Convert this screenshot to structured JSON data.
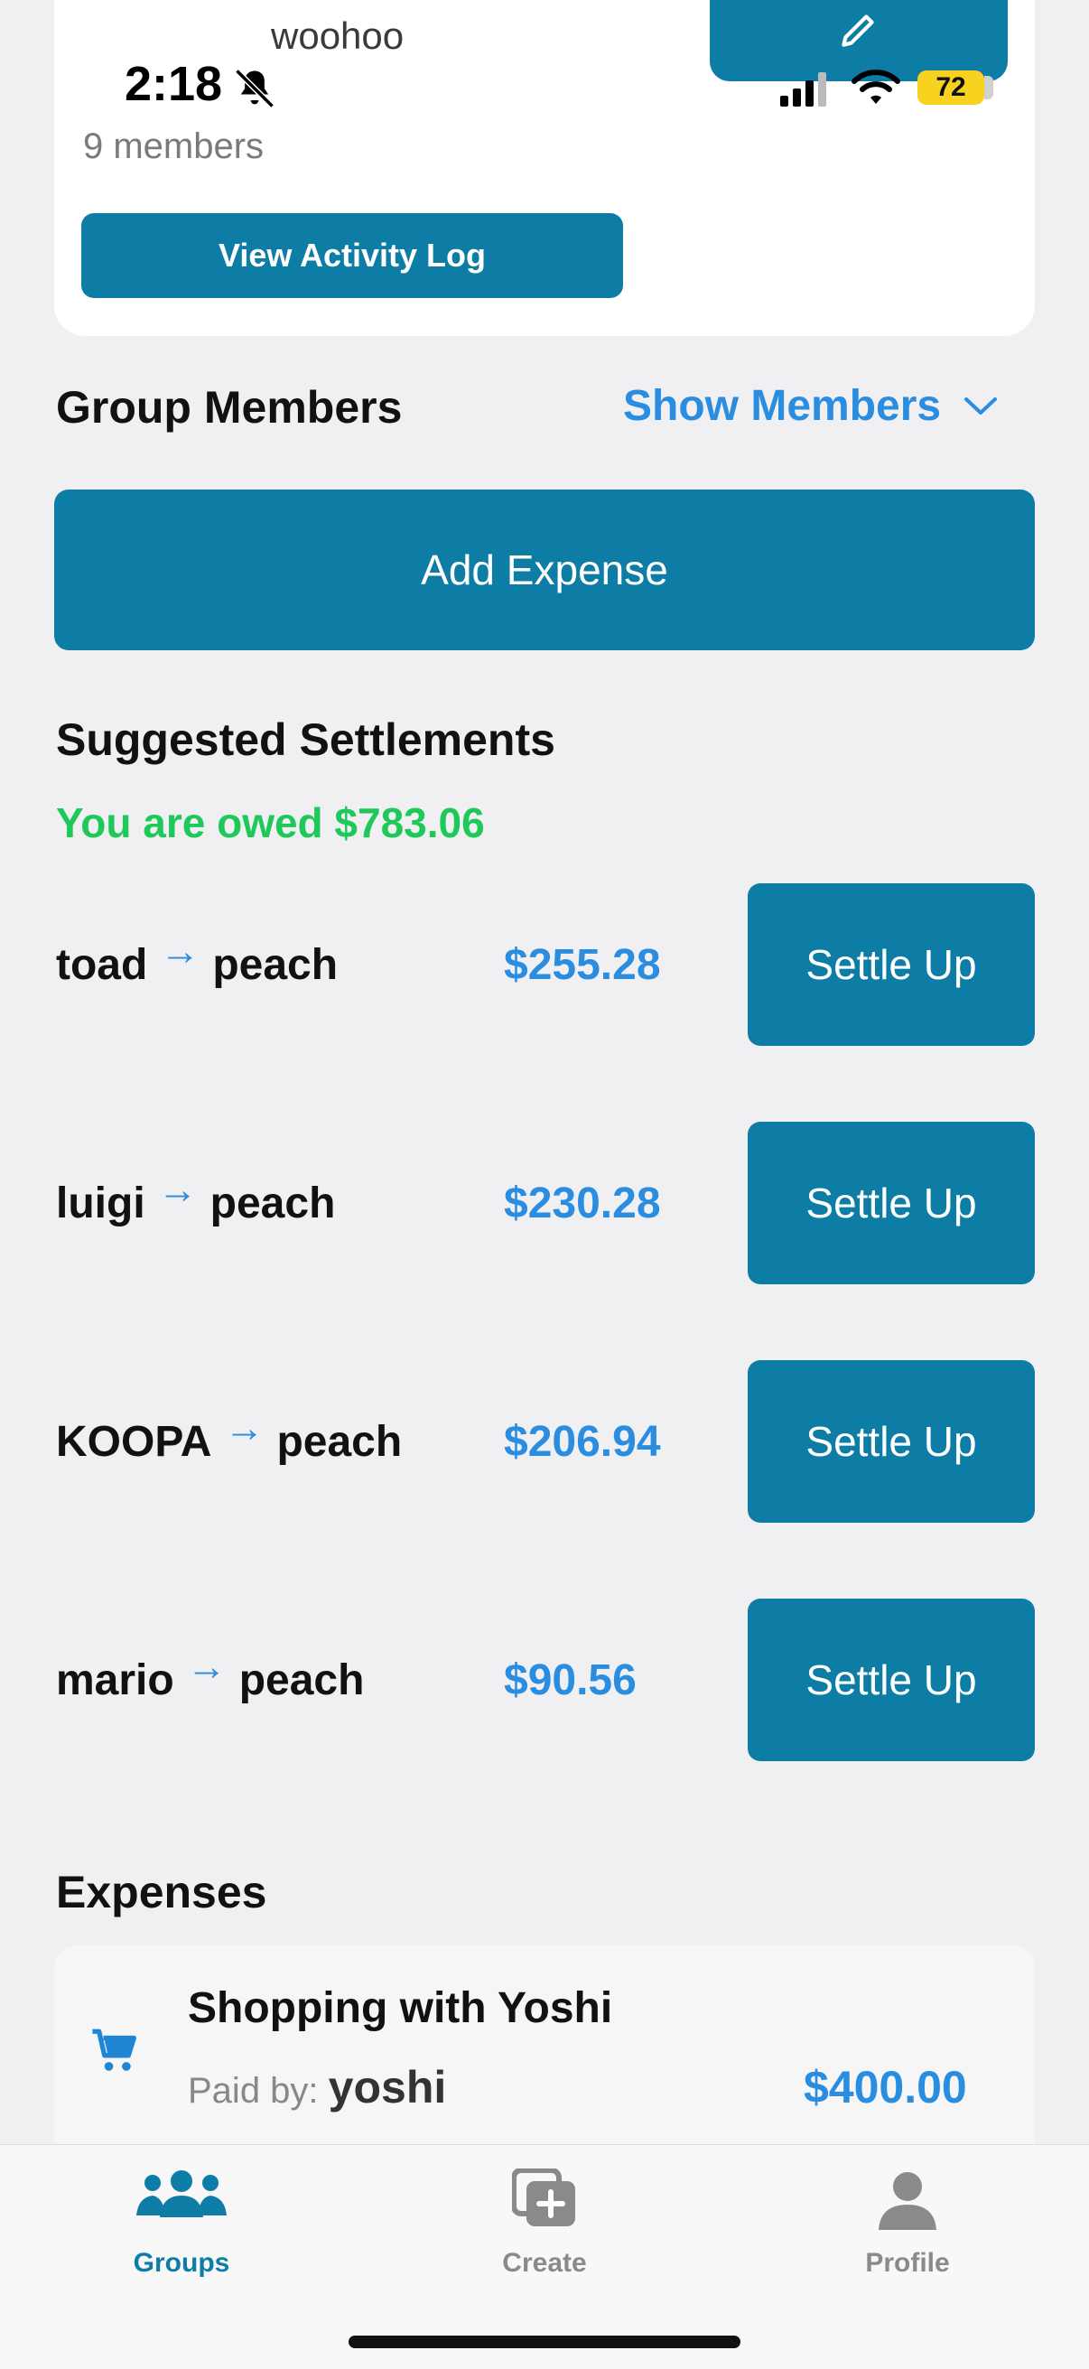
{
  "status": {
    "time": "2:18",
    "battery": "72"
  },
  "group": {
    "name": "woohoo",
    "members_count": "9 members",
    "activity_button": "View Activity Log"
  },
  "members": {
    "title": "Group Members",
    "toggle": "Show Members"
  },
  "actions": {
    "add_expense": "Add Expense"
  },
  "settlements": {
    "title": "Suggested Settlements",
    "summary": "You are owed $783.06",
    "button_label": "Settle Up",
    "items": [
      {
        "from": "toad",
        "to": "peach",
        "amount": "$255.28"
      },
      {
        "from": "luigi",
        "to": "peach",
        "amount": "$230.28"
      },
      {
        "from": "KOOPA",
        "to": "peach",
        "amount": "$206.94"
      },
      {
        "from": "mario",
        "to": "peach",
        "amount": "$90.56"
      }
    ]
  },
  "expenses": {
    "title": "Expenses",
    "items": [
      {
        "title": "Shopping with Yoshi",
        "paid_by_label": "Paid by:",
        "paid_by": "yoshi",
        "amount": "$400.00",
        "icon": "cart-icon"
      }
    ]
  },
  "tabs": [
    {
      "label": "Groups",
      "icon": "groups-icon",
      "active": true
    },
    {
      "label": "Create",
      "icon": "create-icon",
      "active": false
    },
    {
      "label": "Profile",
      "icon": "profile-icon",
      "active": false
    }
  ],
  "colors": {
    "primary": "#0e7da6",
    "accent_blue": "#2a8de0",
    "owed_green": "#1ec95a",
    "background": "#f0f0f2"
  }
}
